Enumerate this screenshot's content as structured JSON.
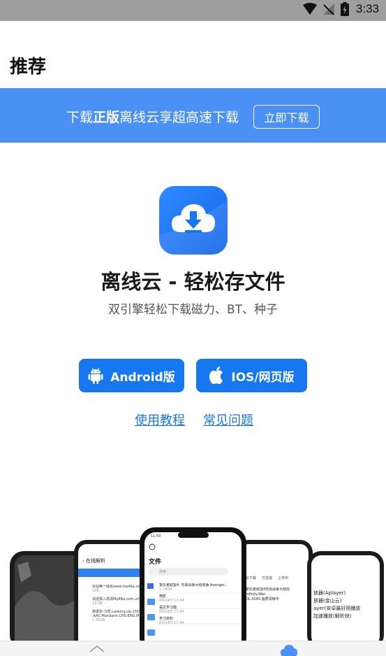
{
  "status_bar": {
    "time": "3:33",
    "icons": [
      "wifi-icon",
      "signal-icon",
      "battery-icon"
    ]
  },
  "header": {
    "title": "推荐"
  },
  "banner": {
    "text_prefix": "下载",
    "text_bold": "正版",
    "text_suffix": "离线云享超高速下载",
    "button_label": "立即下载"
  },
  "app": {
    "icon": "cloud-download-icon",
    "name": "离线云 - 轻松存文件",
    "description": "双引擎轻松下载磁力、BT、种子"
  },
  "downloads": {
    "android_label": "Android版",
    "android_icon": "android-icon",
    "ios_label": "IOS/网页版",
    "ios_icon": "apple-icon"
  },
  "links": {
    "tutorial": "使用教程",
    "faq": "常见问题"
  },
  "phones": {
    "left_screen": {
      "back_label": "在线解析",
      "rows": [
        "本站唯一域名www.mp4ba.com",
        "请选择入高清Mp4Ba.com.urls",
        "镜录年·习惯.Looking.Up.2019",
        ".AAC.Mandarin.CHS-ENG.Mp4"
      ],
      "meta": [
        "10B",
        "13.0B",
        "1.31GB"
      ]
    },
    "center_screen": {
      "time": "11:50",
      "title": "文件",
      "search_placeholder": "搜索",
      "rows": [
        {
          "name": "复仇者联盟4: 无限战争大结局版.Avenger...",
          "meta": "1.74GB"
        },
        {
          "name": "电影",
          "meta": "8月24日 17:44"
        },
        {
          "name": "语文学习题",
          "meta": "8月24日 17:44"
        },
        {
          "name": "学习资料",
          "meta": "8月24日 17:44"
        }
      ]
    },
    "right_screen": {
      "tabs": [
        "云下载",
        "已完成",
        "上传中"
      ],
      "rows": [
        "复仇者联盟4无限战争大结局",
        "Infinity.War.",
        "DL.X265.画质清晰中"
      ]
    },
    "far_right_screen": {
      "rows": [
        "放器(Aplayer)",
        "放器(金山云)",
        "ayer(安卓最好用播放",
        "加速播放(解析快)"
      ]
    }
  },
  "bottom_bar": {
    "icons": [
      "chevron-up-icon",
      "cloud-icon"
    ]
  },
  "colors": {
    "brand": "#1677f0",
    "banner": "#4a90f5",
    "status_bar": "#9e9e9e"
  }
}
